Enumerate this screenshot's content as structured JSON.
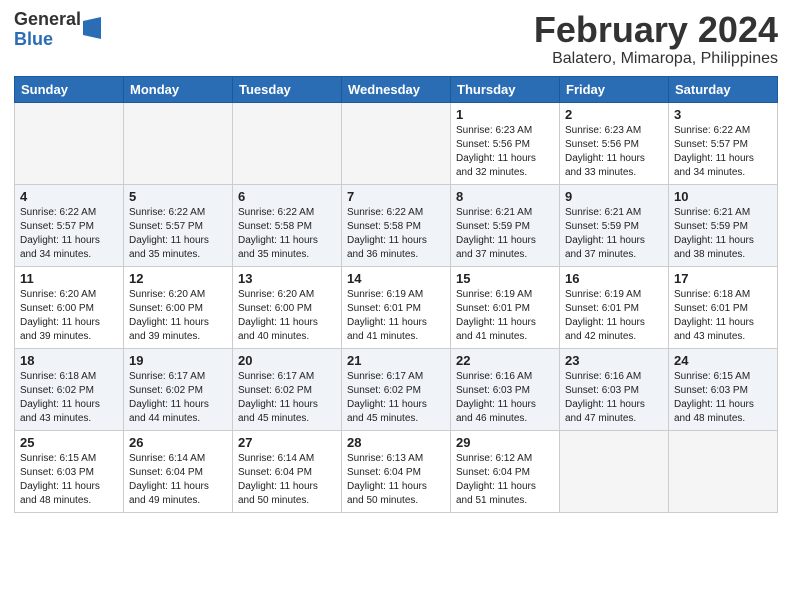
{
  "logo": {
    "general": "General",
    "blue": "Blue"
  },
  "title": {
    "month_year": "February 2024",
    "location": "Balatero, Mimaropa, Philippines"
  },
  "weekdays": [
    "Sunday",
    "Monday",
    "Tuesday",
    "Wednesday",
    "Thursday",
    "Friday",
    "Saturday"
  ],
  "weeks": [
    [
      {
        "day": "",
        "info": ""
      },
      {
        "day": "",
        "info": ""
      },
      {
        "day": "",
        "info": ""
      },
      {
        "day": "",
        "info": ""
      },
      {
        "day": "1",
        "info": "Sunrise: 6:23 AM\nSunset: 5:56 PM\nDaylight: 11 hours and 32 minutes."
      },
      {
        "day": "2",
        "info": "Sunrise: 6:23 AM\nSunset: 5:56 PM\nDaylight: 11 hours and 33 minutes."
      },
      {
        "day": "3",
        "info": "Sunrise: 6:22 AM\nSunset: 5:57 PM\nDaylight: 11 hours and 34 minutes."
      }
    ],
    [
      {
        "day": "4",
        "info": "Sunrise: 6:22 AM\nSunset: 5:57 PM\nDaylight: 11 hours and 34 minutes."
      },
      {
        "day": "5",
        "info": "Sunrise: 6:22 AM\nSunset: 5:57 PM\nDaylight: 11 hours and 35 minutes."
      },
      {
        "day": "6",
        "info": "Sunrise: 6:22 AM\nSunset: 5:58 PM\nDaylight: 11 hours and 35 minutes."
      },
      {
        "day": "7",
        "info": "Sunrise: 6:22 AM\nSunset: 5:58 PM\nDaylight: 11 hours and 36 minutes."
      },
      {
        "day": "8",
        "info": "Sunrise: 6:21 AM\nSunset: 5:59 PM\nDaylight: 11 hours and 37 minutes."
      },
      {
        "day": "9",
        "info": "Sunrise: 6:21 AM\nSunset: 5:59 PM\nDaylight: 11 hours and 37 minutes."
      },
      {
        "day": "10",
        "info": "Sunrise: 6:21 AM\nSunset: 5:59 PM\nDaylight: 11 hours and 38 minutes."
      }
    ],
    [
      {
        "day": "11",
        "info": "Sunrise: 6:20 AM\nSunset: 6:00 PM\nDaylight: 11 hours and 39 minutes."
      },
      {
        "day": "12",
        "info": "Sunrise: 6:20 AM\nSunset: 6:00 PM\nDaylight: 11 hours and 39 minutes."
      },
      {
        "day": "13",
        "info": "Sunrise: 6:20 AM\nSunset: 6:00 PM\nDaylight: 11 hours and 40 minutes."
      },
      {
        "day": "14",
        "info": "Sunrise: 6:19 AM\nSunset: 6:01 PM\nDaylight: 11 hours and 41 minutes."
      },
      {
        "day": "15",
        "info": "Sunrise: 6:19 AM\nSunset: 6:01 PM\nDaylight: 11 hours and 41 minutes."
      },
      {
        "day": "16",
        "info": "Sunrise: 6:19 AM\nSunset: 6:01 PM\nDaylight: 11 hours and 42 minutes."
      },
      {
        "day": "17",
        "info": "Sunrise: 6:18 AM\nSunset: 6:01 PM\nDaylight: 11 hours and 43 minutes."
      }
    ],
    [
      {
        "day": "18",
        "info": "Sunrise: 6:18 AM\nSunset: 6:02 PM\nDaylight: 11 hours and 43 minutes."
      },
      {
        "day": "19",
        "info": "Sunrise: 6:17 AM\nSunset: 6:02 PM\nDaylight: 11 hours and 44 minutes."
      },
      {
        "day": "20",
        "info": "Sunrise: 6:17 AM\nSunset: 6:02 PM\nDaylight: 11 hours and 45 minutes."
      },
      {
        "day": "21",
        "info": "Sunrise: 6:17 AM\nSunset: 6:02 PM\nDaylight: 11 hours and 45 minutes."
      },
      {
        "day": "22",
        "info": "Sunrise: 6:16 AM\nSunset: 6:03 PM\nDaylight: 11 hours and 46 minutes."
      },
      {
        "day": "23",
        "info": "Sunrise: 6:16 AM\nSunset: 6:03 PM\nDaylight: 11 hours and 47 minutes."
      },
      {
        "day": "24",
        "info": "Sunrise: 6:15 AM\nSunset: 6:03 PM\nDaylight: 11 hours and 48 minutes."
      }
    ],
    [
      {
        "day": "25",
        "info": "Sunrise: 6:15 AM\nSunset: 6:03 PM\nDaylight: 11 hours and 48 minutes."
      },
      {
        "day": "26",
        "info": "Sunrise: 6:14 AM\nSunset: 6:04 PM\nDaylight: 11 hours and 49 minutes."
      },
      {
        "day": "27",
        "info": "Sunrise: 6:14 AM\nSunset: 6:04 PM\nDaylight: 11 hours and 50 minutes."
      },
      {
        "day": "28",
        "info": "Sunrise: 6:13 AM\nSunset: 6:04 PM\nDaylight: 11 hours and 50 minutes."
      },
      {
        "day": "29",
        "info": "Sunrise: 6:12 AM\nSunset: 6:04 PM\nDaylight: 11 hours and 51 minutes."
      },
      {
        "day": "",
        "info": ""
      },
      {
        "day": "",
        "info": ""
      }
    ]
  ]
}
